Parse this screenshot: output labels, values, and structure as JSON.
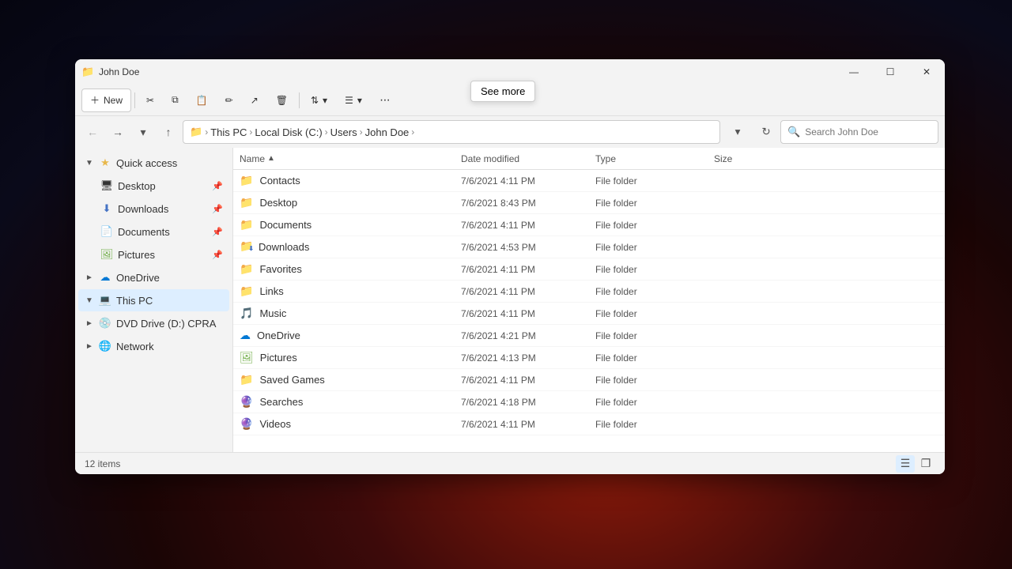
{
  "window": {
    "title": "John Doe",
    "titleIcon": "📁"
  },
  "toolbar": {
    "new_label": "New",
    "see_more_label": "See more",
    "cut_label": "Cut",
    "copy_label": "Copy",
    "paste_label": "Paste",
    "rename_label": "Rename",
    "share_label": "Share",
    "delete_label": "Delete",
    "sort_label": "Sort",
    "view_label": "View",
    "more_label": "···"
  },
  "addressBar": {
    "breadcrumbs": [
      "This PC",
      "Local Disk (C:)",
      "Users",
      "John Doe"
    ],
    "searchPlaceholder": "Search John Doe",
    "breadcrumbIcon": "📁"
  },
  "sidebar": {
    "quickAccess": {
      "label": "Quick access",
      "expanded": true,
      "items": [
        {
          "label": "Desktop",
          "pinned": true
        },
        {
          "label": "Downloads",
          "pinned": true
        },
        {
          "label": "Documents",
          "pinned": true
        },
        {
          "label": "Pictures",
          "pinned": true
        }
      ]
    },
    "oneDrive": {
      "label": "OneDrive",
      "expanded": false
    },
    "thisPC": {
      "label": "This PC",
      "expanded": true
    },
    "dvdDrive": {
      "label": "DVD Drive (D:) CPRA",
      "expanded": false
    },
    "network": {
      "label": "Network",
      "expanded": false
    }
  },
  "fileList": {
    "columns": [
      "Name",
      "Date modified",
      "Type",
      "Size"
    ],
    "files": [
      {
        "name": "Contacts",
        "date": "7/6/2021 4:11 PM",
        "type": "File folder",
        "size": "",
        "iconColor": "yellow"
      },
      {
        "name": "Desktop",
        "date": "7/6/2021 8:43 PM",
        "type": "File folder",
        "size": "",
        "iconColor": "yellow"
      },
      {
        "name": "Documents",
        "date": "7/6/2021 4:11 PM",
        "type": "File folder",
        "size": "",
        "iconColor": "yellow"
      },
      {
        "name": "Downloads",
        "date": "7/6/2021 4:53 PM",
        "type": "File folder",
        "size": "",
        "iconColor": "download"
      },
      {
        "name": "Favorites",
        "date": "7/6/2021 4:11 PM",
        "type": "File folder",
        "size": "",
        "iconColor": "yellow"
      },
      {
        "name": "Links",
        "date": "7/6/2021 4:11 PM",
        "type": "File folder",
        "size": "",
        "iconColor": "yellow"
      },
      {
        "name": "Music",
        "date": "7/6/2021 4:11 PM",
        "type": "File folder",
        "size": "",
        "iconColor": "music"
      },
      {
        "name": "OneDrive",
        "date": "7/6/2021 4:21 PM",
        "type": "File folder",
        "size": "",
        "iconColor": "onedrive"
      },
      {
        "name": "Pictures",
        "date": "7/6/2021 4:13 PM",
        "type": "File folder",
        "size": "",
        "iconColor": "pictures"
      },
      {
        "name": "Saved Games",
        "date": "7/6/2021 4:11 PM",
        "type": "File folder",
        "size": "",
        "iconColor": "yellow"
      },
      {
        "name": "Searches",
        "date": "7/6/2021 4:18 PM",
        "type": "File folder",
        "size": "",
        "iconColor": "purple"
      },
      {
        "name": "Videos",
        "date": "7/6/2021 4:11 PM",
        "type": "File folder",
        "size": "",
        "iconColor": "purple"
      }
    ]
  },
  "statusBar": {
    "itemCount": "12 items"
  }
}
